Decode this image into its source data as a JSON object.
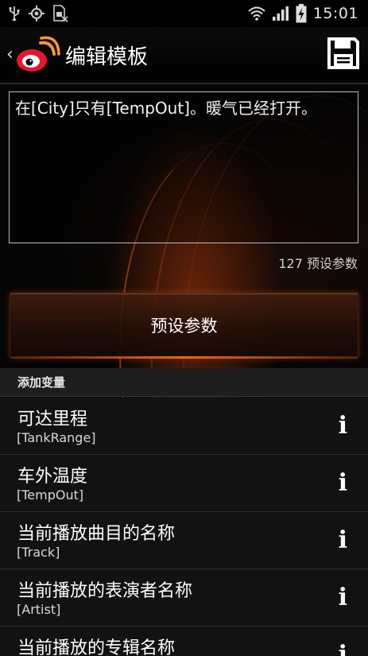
{
  "status_bar": {
    "time": "15:01",
    "icons": [
      "usb-icon",
      "gps-icon",
      "sim-missing-icon",
      "wifi-icon",
      "cell-signal-icon",
      "battery-charging-icon"
    ]
  },
  "header": {
    "title": "编辑模板",
    "back_icon": "chevron-left-icon",
    "app_logo": "weibo-logo",
    "save_icon": "floppy-disk-icon"
  },
  "editor": {
    "template_text": "在[City]只有[TempOut]。暖气已经打开。",
    "char_count": "127 预设参数"
  },
  "preset_button": {
    "label": "预设参数"
  },
  "variables": {
    "section_title": "添加变量",
    "items": [
      {
        "name": "可达里程",
        "token": "[TankRange]"
      },
      {
        "name": "车外温度",
        "token": "[TempOut]"
      },
      {
        "name": "当前播放曲目的名称",
        "token": "[Track]"
      },
      {
        "name": "当前播放的表演者名称",
        "token": "[Artist]"
      },
      {
        "name": "当前播放的专辑名称",
        "token": ""
      }
    ],
    "info_glyph": "i"
  },
  "colors": {
    "accent_orange": "#e05a1a",
    "logo_red": "#e6162d",
    "logo_orange": "#ff9933",
    "list_bg": "#121212"
  }
}
